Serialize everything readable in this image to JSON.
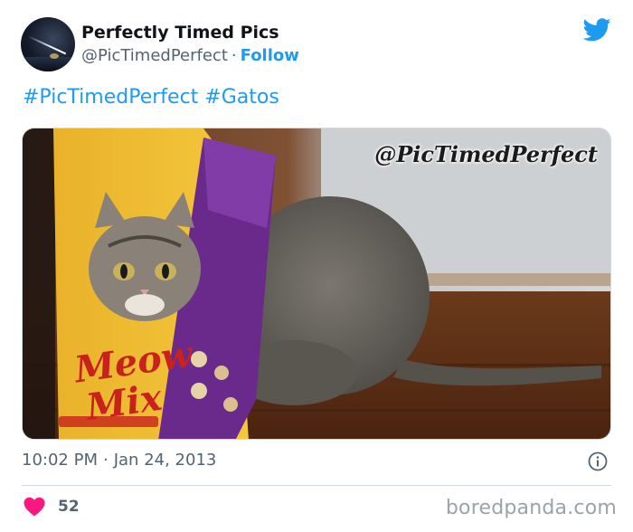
{
  "author": {
    "name": "Perfectly Timed Pics",
    "handle": "@PicTimedPerfect",
    "separator": "·",
    "follow_label": "Follow"
  },
  "header": {
    "logo_icon": "twitter-bird-icon"
  },
  "tweet": {
    "hashtags": [
      "#PicTimedPerfect",
      "#Gatos"
    ]
  },
  "media": {
    "watermark": "@PicTimedPerfect",
    "bag_logo": "Meow Mix"
  },
  "meta": {
    "time": "10:02 PM",
    "separator": "·",
    "date": "Jan 24, 2013",
    "info_icon": "info-icon"
  },
  "engagement": {
    "likes": "52",
    "like_icon": "heart-icon"
  },
  "footer": {
    "brand": "boredpanda.com"
  },
  "colors": {
    "accent": "#1d9bf0",
    "heart": "#f91880",
    "muted": "#536471",
    "brand": "#9aa3a9"
  }
}
